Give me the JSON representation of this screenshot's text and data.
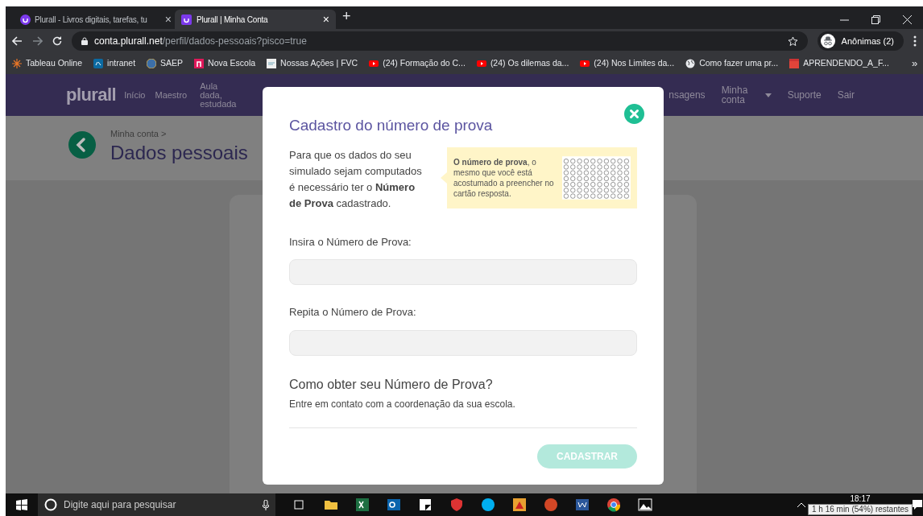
{
  "browser": {
    "tabs": [
      {
        "title": "Plurall - Livros digitais, tarefas, tu",
        "selected": false,
        "close": "×"
      },
      {
        "title": "Plurall | Minha Conta",
        "selected": true,
        "close": "×"
      }
    ],
    "new_tab": "+",
    "url_host": "conta.plurall.net",
    "url_path": "/perfil/dados-pessoais?pisco=true",
    "profile": "Anônimas (2)",
    "bookmarks": [
      {
        "label": "Tableau Online",
        "kind": "tableau"
      },
      {
        "label": "intranet",
        "kind": "sharepoint"
      },
      {
        "label": "SAEP",
        "kind": "globe-blue"
      },
      {
        "label": "Nova Escola",
        "kind": "n"
      },
      {
        "label": "Nossas Ações | FVC",
        "kind": "page"
      },
      {
        "label": "(24) Formação do C...",
        "kind": "youtube"
      },
      {
        "label": "(24) Os dilemas da...",
        "kind": "youtube"
      },
      {
        "label": "(24) Nos Limites da...",
        "kind": "youtube"
      },
      {
        "label": "Como fazer uma pr...",
        "kind": "globe"
      },
      {
        "label": "APRENDENDO_A_F...",
        "kind": "clapper"
      }
    ],
    "more": "»"
  },
  "site": {
    "logo": "plurall",
    "nav": [
      {
        "label": "Início"
      },
      {
        "label": "Maestro"
      },
      {
        "label": "Aula dada, estudada"
      }
    ],
    "nav_right": [
      {
        "label": "nsagens",
        "kind": "link"
      },
      {
        "label": "Minha conta",
        "kind": "menu"
      },
      {
        "label": "Suporte",
        "kind": "link"
      },
      {
        "label": "Sair",
        "kind": "link"
      }
    ],
    "breadcrumb": "Minha conta >",
    "page_title": "Dados pessoais"
  },
  "modal": {
    "title": "Cadastro do número de prova",
    "intro": "Para que os dados do seu simulado sejam computados é necessário ter o **Número de Prova** cadastrado.",
    "hint": "**O número de prova**, o mesmo que você está acostumado a preencher no cartão resposta.",
    "fields": [
      {
        "label": "Insira o Número de Prova:"
      },
      {
        "label": "Repita o Número de Prova:"
      }
    ],
    "help_title": "Como obter seu Número de Prova?",
    "help_text": "Entre em contato com a coordenação da sua escola.",
    "submit": {
      "label": "CADASTRAR",
      "disabled": true
    }
  },
  "taskbar": {
    "search_placeholder": "Digite aqui para pesquisar",
    "clock": "18:17",
    "battery_tooltip": "1 h 16 min (54%) restantes"
  }
}
